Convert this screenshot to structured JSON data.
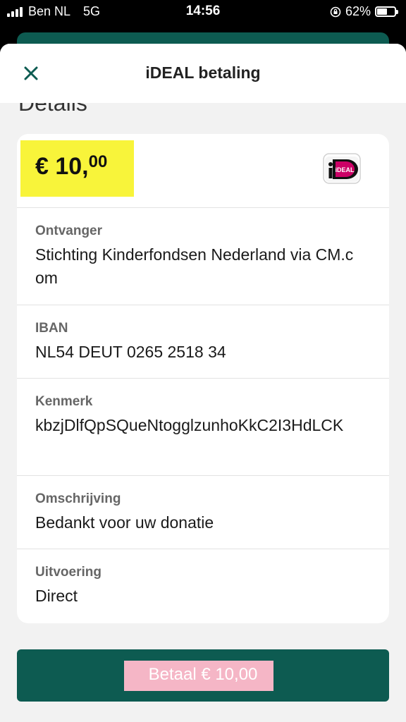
{
  "status_bar": {
    "carrier": "Ben NL",
    "network": "5G",
    "time": "14:56",
    "battery": "62%",
    "battery_level": 0.62
  },
  "header": {
    "title": "iDEAL betaling"
  },
  "section": {
    "title": "Details"
  },
  "amount": {
    "main": "€ 10,",
    "cents": "00",
    "logo_text": "iDEAL"
  },
  "details": {
    "ontvanger_label": "Ontvanger",
    "ontvanger_value": "Stichting Kinderfondsen Nederland via CM.com",
    "iban_label": "IBAN",
    "iban_value": "NL54 DEUT 0265 2518 34",
    "kenmerk_label": "Kenmerk",
    "kenmerk_value": "kbzjDlfQpSQueNtogglzunhoKkC2I3HdLCK",
    "omschrijving_label": "Omschrijving",
    "omschrijving_value": "Bedankt voor uw donatie",
    "uitvoering_label": "Uitvoering",
    "uitvoering_value": "Direct"
  },
  "pay_button": {
    "label": "Betaal € 10,00"
  },
  "colors": {
    "primary": "#0d5b51",
    "highlight_yellow": "#f8f43a",
    "highlight_pink": "#f5b6c6",
    "ideal_pink": "#cc0066"
  }
}
